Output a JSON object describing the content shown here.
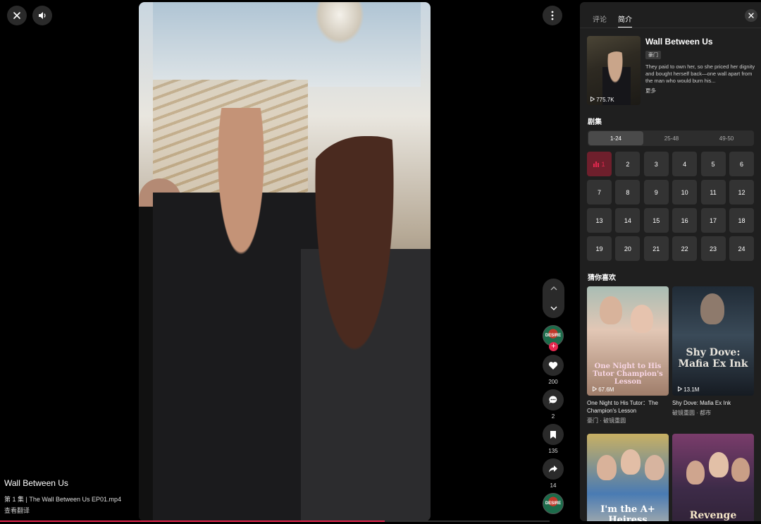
{
  "player": {
    "title": "Wall Between Us",
    "episode_line": "第 1 集 | The Wall Between Us EP01.mp4",
    "translate_label": "查看翻译",
    "progress_fraction": 0.7
  },
  "actions": {
    "like_count": "200",
    "comment_count": "2",
    "bookmark_count": "135",
    "share_count": "14",
    "avatar_label": "DESIRE"
  },
  "panel": {
    "tabs": [
      {
        "label": "评论",
        "active": false
      },
      {
        "label": "简介",
        "active": true
      }
    ],
    "drama": {
      "title": "Wall Between Us",
      "genre": "豪门",
      "synopsis": "They paid to own her, so she priced her dignity and bought herself back—one wall apart from the man who would burn his...",
      "more_label": "更多",
      "views": "775.7K"
    },
    "episodes_heading": "剧集",
    "ranges": [
      {
        "label": "1-24",
        "active": true
      },
      {
        "label": "25-48",
        "active": false
      },
      {
        "label": "49-50",
        "active": false
      }
    ],
    "episodes": [
      "1",
      "2",
      "3",
      "4",
      "5",
      "6",
      "7",
      "8",
      "9",
      "10",
      "11",
      "12",
      "13",
      "14",
      "15",
      "16",
      "17",
      "18",
      "19",
      "20",
      "21",
      "22",
      "23",
      "24"
    ],
    "current_episode": "1",
    "recommend_heading": "猜你喜欢",
    "recommendations": [
      {
        "title": "One Night to His Tutor：The Champion's Lesson",
        "tags": "豪门 · 破镜重圆",
        "views": "67.6M",
        "cover_text": "One Night to His Tutor Champion's Lesson"
      },
      {
        "title": "Shy Dove: Mafia Ex Ink",
        "tags": "破镜重圆 · 都市",
        "views": "13.1M",
        "cover_text": "Shy Dove: Mafia Ex Ink"
      },
      {
        "title": "",
        "tags": "",
        "views": "",
        "cover_text": "I'm the A+ Heiress"
      },
      {
        "title": "",
        "tags": "",
        "views": "",
        "cover_text": "Revenge"
      }
    ]
  },
  "colors": {
    "accent": "#e5284f",
    "panel_bg": "#1f1f1f",
    "tile_bg": "#333333",
    "active_tile_bg": "#6e1f2c"
  }
}
